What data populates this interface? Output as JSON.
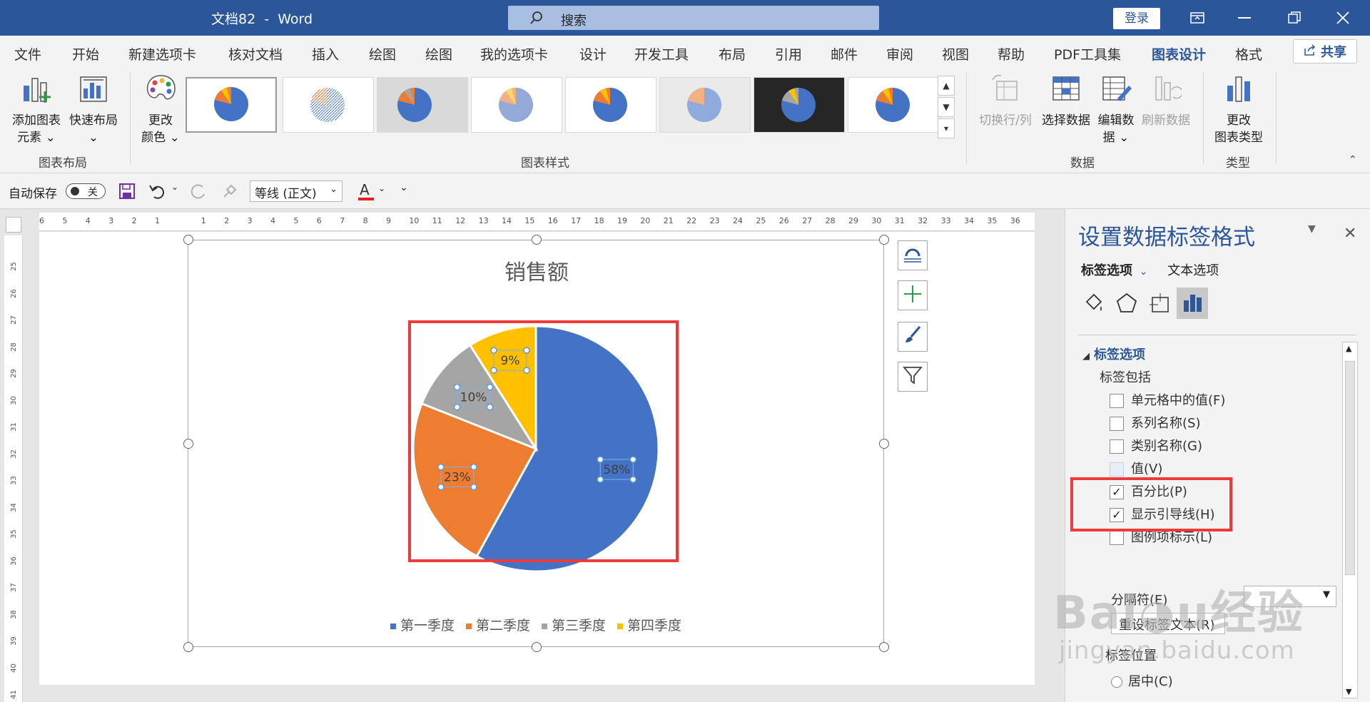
{
  "window": {
    "title": "文档82  -  Word",
    "search_placeholder": "搜索",
    "login_label": "登录"
  },
  "ribbon": {
    "tabs": [
      "文件",
      "开始",
      "新建选项卡",
      "核对文档",
      "插入",
      "绘图",
      "绘图",
      "我的选项卡",
      "设计",
      "开发工具",
      "布局",
      "引用",
      "邮件",
      "审阅",
      "视图",
      "帮助",
      "PDF工具集",
      "图表设计",
      "格式"
    ],
    "active_tab": "图表设计",
    "share_label": "共享",
    "add_element": [
      "添加图表",
      "元素"
    ],
    "quick_layout": "快速布局",
    "change_colors": [
      "更改",
      "颜色"
    ],
    "switch_row_col": "切换行/列",
    "select_data": "选择数据",
    "edit_data": [
      "编辑数",
      "据"
    ],
    "refresh_data": "刷新数据",
    "change_type": [
      "更改",
      "图表类型"
    ],
    "group_layout": "图表布局",
    "group_styles": "图表样式",
    "group_data": "数据",
    "group_type": "类型"
  },
  "qat": {
    "autosave_label": "自动保存",
    "autosave_state": "关",
    "font_name": "等线 (正文)"
  },
  "ruler": {
    "h_ticks": [
      "6",
      "5",
      "4",
      "3",
      "2",
      "1",
      "",
      "1",
      "2",
      "3",
      "4",
      "5",
      "6",
      "7",
      "8",
      "9",
      "10",
      "11",
      "12",
      "13",
      "14",
      "15",
      "16",
      "17",
      "18",
      "19",
      "20",
      "21",
      "22",
      "23",
      "24",
      "25",
      "26",
      "27",
      "28",
      "29",
      "30",
      "31",
      "32",
      "33",
      "34",
      "35",
      "36"
    ],
    "v_ticks": [
      "25",
      "26",
      "27",
      "28",
      "29",
      "30",
      "31",
      "32",
      "33",
      "34",
      "35",
      "36",
      "37",
      "38",
      "39",
      "40",
      "41"
    ]
  },
  "chart_data": {
    "type": "pie",
    "title": "销售额",
    "categories": [
      "第一季度",
      "第二季度",
      "第三季度",
      "第四季度"
    ],
    "values": [
      58,
      23,
      10,
      9
    ],
    "labels": [
      "58%",
      "23%",
      "10%",
      "9%"
    ],
    "colors": [
      "#4472c4",
      "#ed7d31",
      "#a5a5a5",
      "#ffc000"
    ],
    "legend_position": "bottom"
  },
  "pane": {
    "title": "设置数据标签格式",
    "tab_label_options": "标签选项",
    "tab_text_options": "文本选项",
    "section_title": "标签选项",
    "sub_title": "标签包括",
    "checkboxes": [
      {
        "label": "单元格中的值(F)",
        "checked": false
      },
      {
        "label": "系列名称(S)",
        "checked": false
      },
      {
        "label": "类别名称(G)",
        "checked": false
      },
      {
        "label": "值(V)",
        "checked": false
      },
      {
        "label": "百分比(P)",
        "checked": true
      },
      {
        "label": "显示引导线(H)",
        "checked": true
      },
      {
        "label": "图例项标示(L)",
        "checked": false
      }
    ],
    "separator_label": "分隔符(E)",
    "reset_label": "重设标签文本(R)",
    "position_label": "标签位置",
    "position_option": "居中(C)"
  },
  "watermark": {
    "brand": "Baidu经验",
    "url": "jingyan.baidu.com"
  }
}
